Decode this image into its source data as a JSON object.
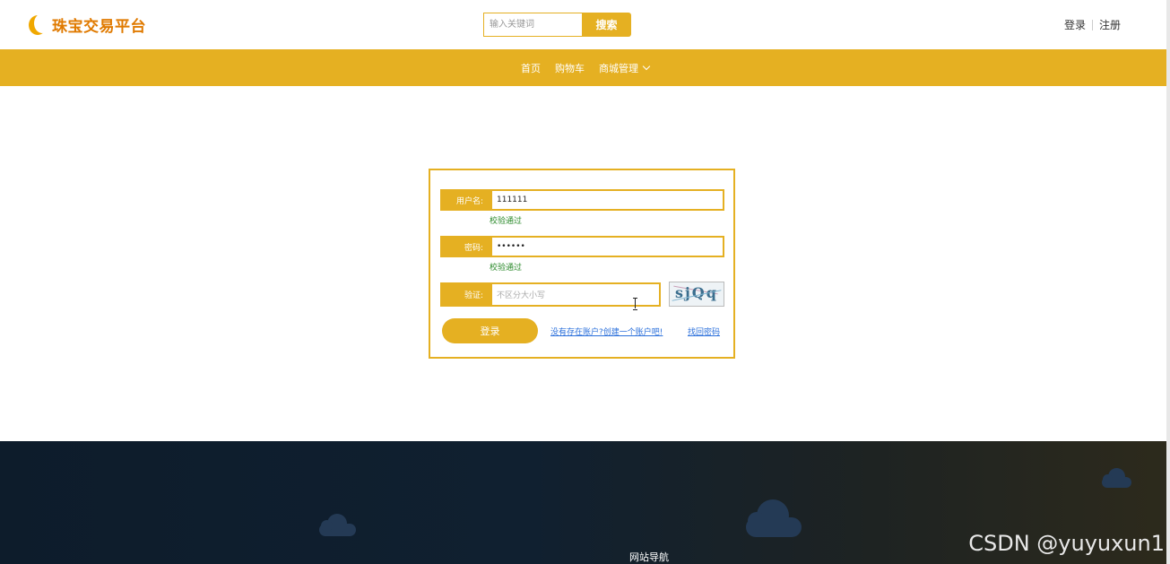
{
  "header": {
    "brand": "珠宝交易平台",
    "search_placeholder": "输入关键词",
    "search_button": "搜索",
    "login_link": "登录",
    "register_link": "注册"
  },
  "nav": {
    "items": [
      "首页",
      "购物车",
      "商城管理"
    ]
  },
  "login_form": {
    "username_label": "用户名:",
    "username_value": "111111",
    "username_hint": "校验通过",
    "password_label": "密码:",
    "password_value": "••••••",
    "password_hint": "校验通过",
    "captcha_label": "验证:",
    "captcha_placeholder": "不区分大小写",
    "captcha_text": "sjQq",
    "login_button": "登录",
    "register_link": "没有存在账户?创建一个账户吧!",
    "forgot_link": "找回密码"
  },
  "footer": {
    "site_nav": "网站导航",
    "watermark": "CSDN @yuyuxun1"
  },
  "colors": {
    "accent": "#e5b022",
    "brand": "#e07a00",
    "hint_green": "#2b8a2b",
    "link_blue": "#2a6fdb"
  }
}
